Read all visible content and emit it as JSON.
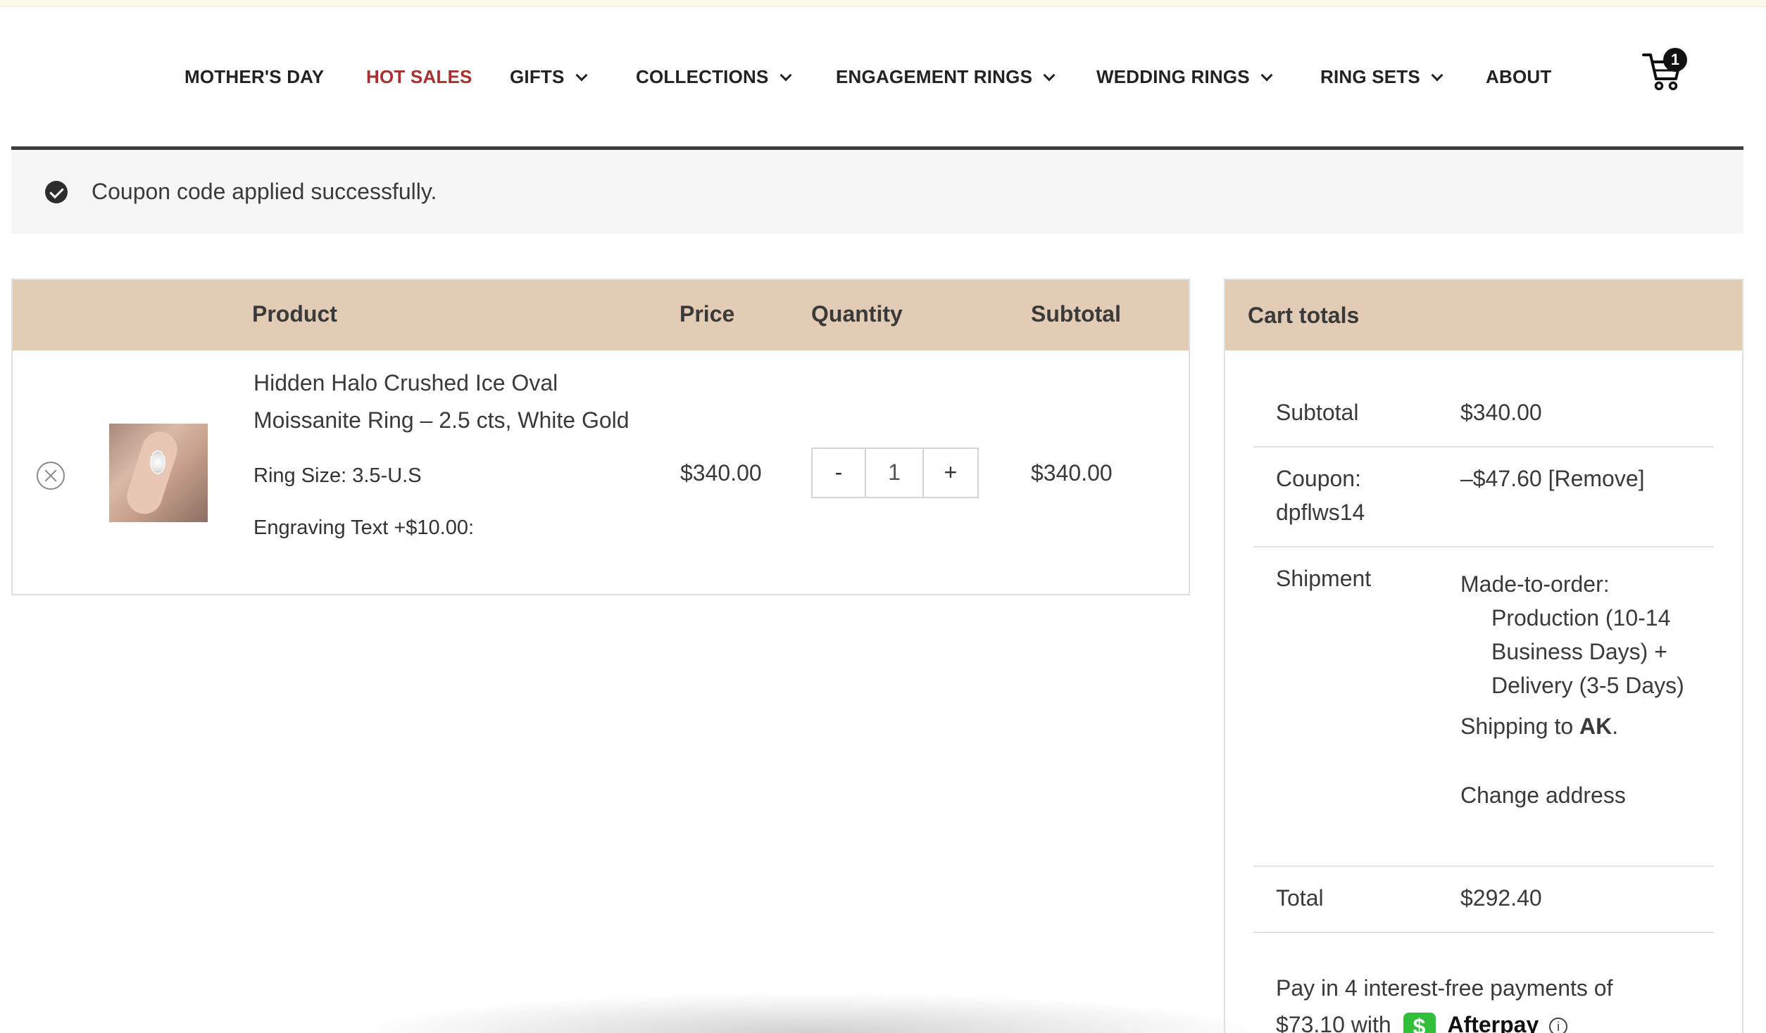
{
  "nav": {
    "items": [
      {
        "label": "MOTHER'S DAY"
      },
      {
        "label": "HOT SALES"
      },
      {
        "label": "GIFTS"
      },
      {
        "label": "COLLECTIONS"
      },
      {
        "label": "ENGAGEMENT RINGS"
      },
      {
        "label": "WEDDING RINGS"
      },
      {
        "label": "RING SETS"
      },
      {
        "label": "ABOUT"
      }
    ],
    "cart_count": "1",
    "accent_color": "#a8312f"
  },
  "notice": {
    "message": "Coupon code applied successfully."
  },
  "cart_table": {
    "headers": {
      "product": "Product",
      "price": "Price",
      "quantity": "Quantity",
      "subtotal": "Subtotal"
    },
    "header_color": "#e2ccb6",
    "row": {
      "product_name_line1": "Hidden Halo Crushed Ice Oval",
      "product_name_line2": "Moissanite Ring – 2.5 cts, White Gold",
      "ring_size": "Ring Size: 3.5-U.S",
      "engraving": "Engraving Text +$10.00:",
      "price": "$340.00",
      "qty_minus": "-",
      "quantity": "1",
      "qty_plus": "+",
      "subtotal": "$340.00"
    }
  },
  "cart_totals": {
    "title": "Cart totals",
    "subtotal_label": "Subtotal",
    "subtotal_value": "$340.00",
    "coupon_label_line1": "Coupon:",
    "coupon_label_line2": "dpflws14",
    "coupon_value": "–$47.60",
    "coupon_remove": "[Remove]",
    "shipment_label": "Shipment",
    "shipment_method": "Made-to-order:",
    "shipment_lines": [
      "Production (10-14",
      "Business Days) +",
      "Delivery (3-5 Days)"
    ],
    "shipping_to_prefix": "Shipping to",
    "shipping_to_region": "AK",
    "change_address": "Change address",
    "total_label": "Total",
    "total_value": "$292.40",
    "pay_line1": "Pay in 4 interest-free payments of",
    "pay_amount": "$73.10 with",
    "afterpay_badge": "$",
    "afterpay_label": "Afterpay",
    "afterpay_badge_color": "#2fbf3b"
  }
}
